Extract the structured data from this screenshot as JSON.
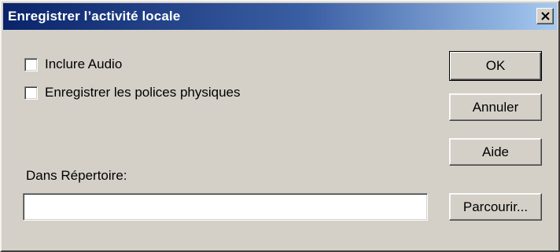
{
  "window": {
    "title": "Enregistrer l’activité locale",
    "close_label": "×"
  },
  "options": {
    "include_audio": {
      "label": "Inclure Audio",
      "checked": false
    },
    "record_fonts": {
      "label": "Enregistrer les polices physiques",
      "checked": false
    }
  },
  "directory": {
    "label": "Dans Répertoire:",
    "value": ""
  },
  "buttons": {
    "ok": "OK",
    "cancel": "Annuler",
    "help": "Aide",
    "browse": "Parcourir..."
  },
  "colors": {
    "titlebar_start": "#0a246a",
    "titlebar_end": "#a6caf0",
    "dialog_face": "#d4d0c8"
  }
}
